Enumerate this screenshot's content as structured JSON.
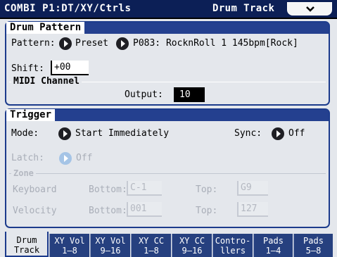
{
  "header": {
    "title": "COMBI P1:DT/XY/Ctrls",
    "page": "Drum Track"
  },
  "drum_pattern": {
    "section_label": "Drum Pattern",
    "pattern_label": "Pattern:",
    "bank": "Preset",
    "pattern_value": "P083: RocknRoll 1 145bpm[Rock]",
    "shift_label": "Shift:",
    "shift_value": "+00",
    "midi_label": "MIDI Channel",
    "output_label": "Output:",
    "output_value": "10"
  },
  "trigger": {
    "section_label": "Trigger",
    "mode_label": "Mode:",
    "mode_value": "Start Immediately",
    "sync_label": "Sync:",
    "sync_value": "Off",
    "latch_label": "Latch:",
    "latch_value": "Off",
    "zone_label": "Zone",
    "keyboard_label": "Keyboard",
    "keyboard_bottom_label": "Bottom:",
    "keyboard_bottom_value": "C-1",
    "keyboard_top_label": "Top:",
    "keyboard_top_value": "G9",
    "velocity_label": "Velocity",
    "velocity_bottom_label": "Bottom:",
    "velocity_bottom_value": "001",
    "velocity_top_label": "Top:",
    "velocity_top_value": "127"
  },
  "tabs": [
    {
      "line1": "Drum",
      "line2": "Track"
    },
    {
      "line1": "XY Vol",
      "line2": "1–8"
    },
    {
      "line1": "XY Vol",
      "line2": "9–16"
    },
    {
      "line1": "XY CC",
      "line2": "1–8"
    },
    {
      "line1": "XY CC",
      "line2": "9–16"
    },
    {
      "line1": "Contro-",
      "line2": "llers"
    },
    {
      "line1": "Pads",
      "line2": "1–4"
    },
    {
      "line1": "Pads",
      "line2": "5–8"
    }
  ],
  "colors": {
    "title_bar": "#0c1f56",
    "section_header": "#24408f",
    "tab_inactive": "#26407f",
    "background": "#e4e7ec"
  }
}
